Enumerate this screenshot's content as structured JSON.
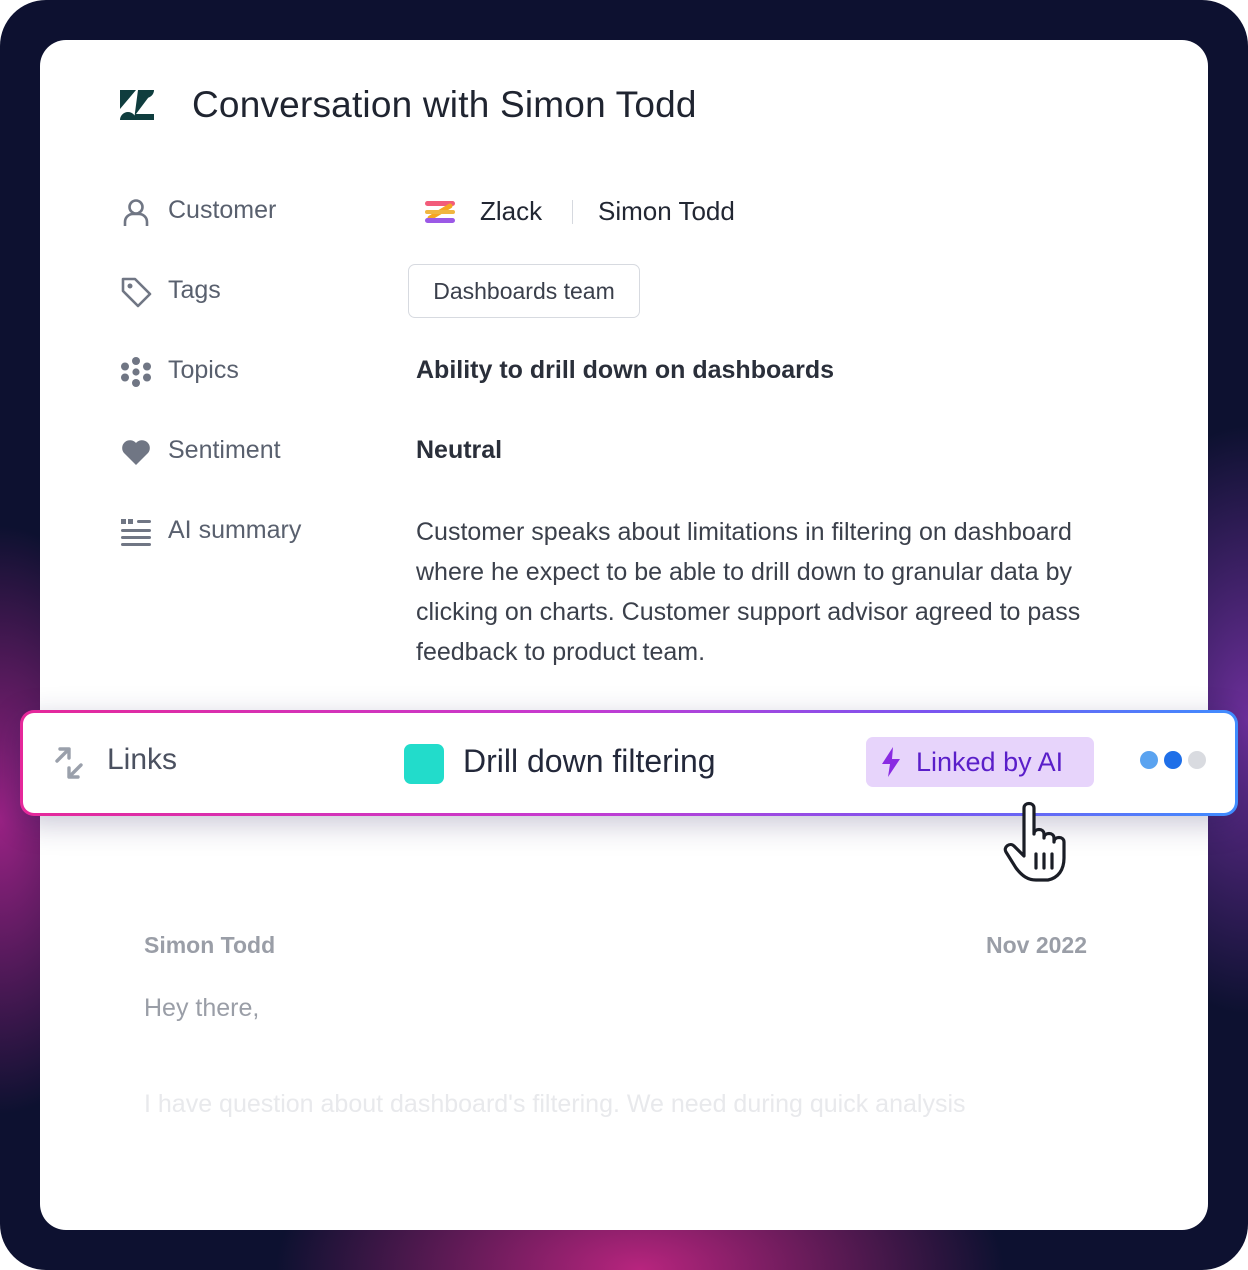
{
  "title": "Conversation with Simon Todd",
  "fields": {
    "customer": {
      "label": "Customer",
      "company": "Zlack",
      "name": "Simon Todd"
    },
    "tags": {
      "label": "Tags",
      "chip": "Dashboards team"
    },
    "topics": {
      "label": "Topics",
      "value": "Ability to drill down on dashboards"
    },
    "sentiment": {
      "label": "Sentiment",
      "value": "Neutral"
    },
    "summary": {
      "label": "AI summary",
      "value": "Customer speaks about limitations in filtering on dashboard where he expect to be able to drill down to granular data by clicking on charts. Customer support advisor agreed to pass feedback to product team."
    }
  },
  "links": {
    "label": "Links",
    "item": "Drill down filtering",
    "badge": "Linked by AI",
    "colors": {
      "teal": "#22dccb",
      "badge_bg": "#e7d4fb",
      "badge_text": "#5a1ec9"
    }
  },
  "message": {
    "author": "Simon Todd",
    "date": "Nov 2022",
    "greeting": "Hey there,",
    "body": "I have question about dashboard's filtering. We need during quick analysis"
  },
  "icons": [
    "zendesk-logo-icon",
    "user-icon",
    "tag-icon",
    "topics-icon",
    "heart-icon",
    "summary-icon",
    "zlack-logo-icon",
    "links-icon",
    "bolt-icon",
    "more-dots-icon",
    "hand-cursor-icon"
  ]
}
